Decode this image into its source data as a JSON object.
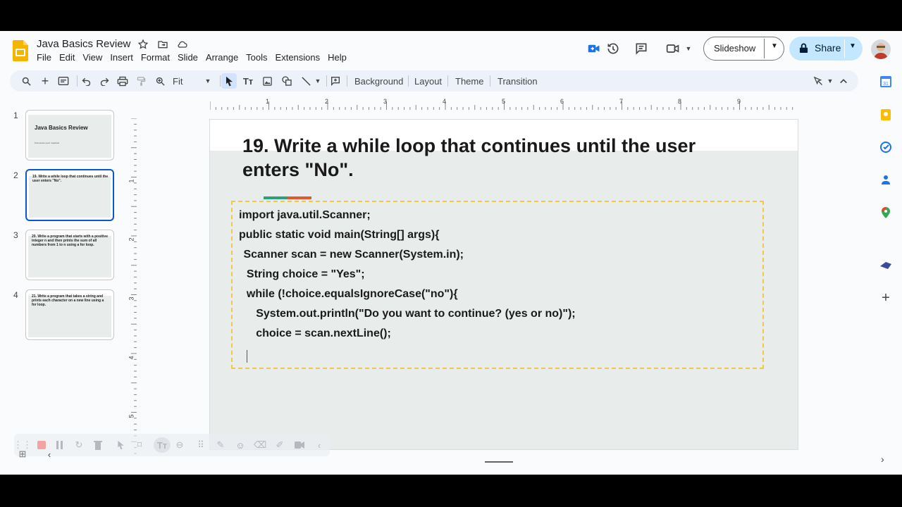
{
  "app": {
    "doc_title": "Java Basics Review",
    "menu": [
      "File",
      "Edit",
      "View",
      "Insert",
      "Format",
      "Slide",
      "Arrange",
      "Tools",
      "Extensions",
      "Help"
    ],
    "slideshow_label": "Slideshow",
    "share_label": "Share"
  },
  "toolbar": {
    "zoom_value": "Fit",
    "background_label": "Background",
    "layout_label": "Layout",
    "theme_label": "Theme",
    "transition_label": "Transition"
  },
  "filmstrip": [
    {
      "num": "1",
      "title": "Java Basics Review",
      "subtitle": "Post-lesson quiz materials"
    },
    {
      "num": "2",
      "title": "19. Write a while loop that continues until the user enters \"No\"."
    },
    {
      "num": "3",
      "title": "20. Write a program that starts with a positive integer n and then prints the sum of all numbers from 1 to n using a for loop."
    },
    {
      "num": "4",
      "title": "21. Write a program that takes a string and prints each character on a new line using a for loop."
    }
  ],
  "ruler": {
    "h": [
      "1",
      "2",
      "3",
      "4",
      "5",
      "6",
      "7",
      "8",
      "9"
    ],
    "v": [
      "1",
      "2",
      "3",
      "4",
      "5"
    ]
  },
  "slide": {
    "title_line1": "19. Write a while loop that continues until the user",
    "title_line2": "enters \"No\".",
    "code": [
      "import java.util.Scanner;",
      "public static void main(String[] args){",
      " Scanner scan = new Scanner(System.in);",
      "  String choice = \"Yes\";",
      "  while (!choice.equalsIgnoreCase(\"no\"){",
      "     System.out.println(\"Do you want to continue? (yes or no)\");",
      "     choice = scan.nextLine();"
    ]
  },
  "colors": {
    "accent_green": "#2e9e7c",
    "accent_orange": "#e05a2b",
    "share_bg": "#c2e7ff",
    "selected_blue": "#0b57d0"
  }
}
